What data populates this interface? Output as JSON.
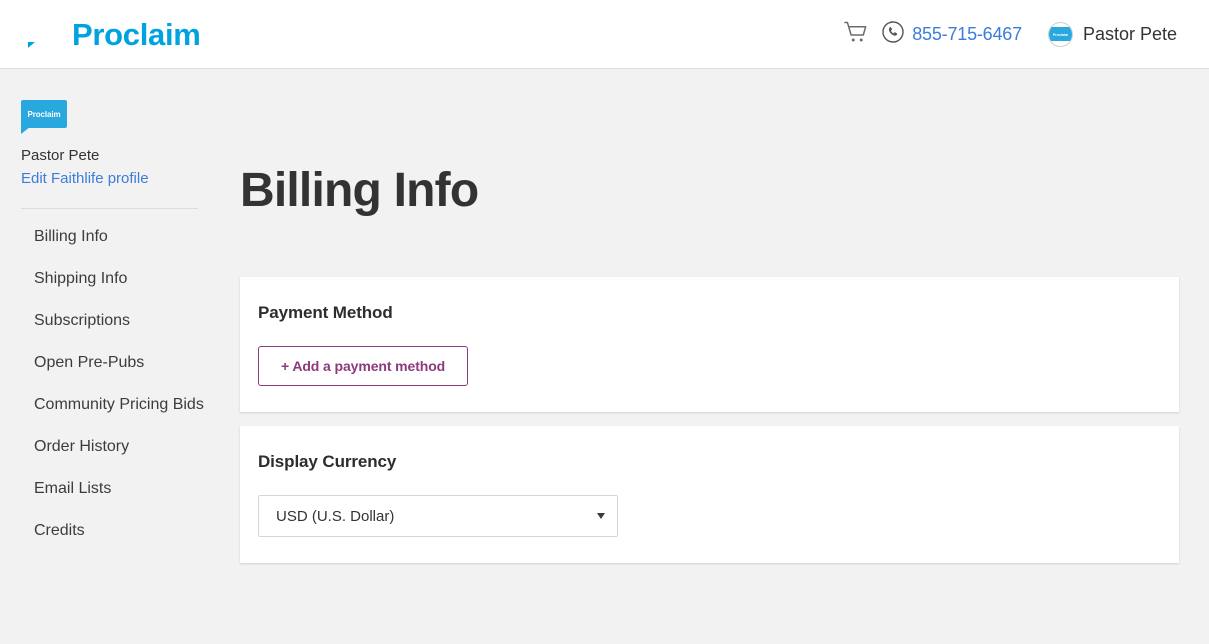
{
  "header": {
    "brand_name": "Proclaim",
    "brand_color": "#00a3e0",
    "cart_icon": "shopping-cart-icon",
    "phone_icon": "phone-circle-icon",
    "phone_number": "855-715-6467",
    "phone_link_color": "#3b7dd8",
    "user_name": "Pastor Pete",
    "avatar_icon": "proclaim-avatar-icon",
    "avatar_label": "Proclaim"
  },
  "sidebar": {
    "logo_label": "Proclaim",
    "user_name": "Pastor Pete",
    "edit_profile_label": "Edit Faithlife profile",
    "items": [
      {
        "label": "Billing Info"
      },
      {
        "label": "Shipping Info"
      },
      {
        "label": "Subscriptions"
      },
      {
        "label": "Open Pre-Pubs"
      },
      {
        "label": "Community Pricing Bids"
      },
      {
        "label": "Order History"
      },
      {
        "label": "Email Lists"
      },
      {
        "label": "Credits"
      }
    ]
  },
  "main": {
    "page_title": "Billing Info",
    "payment_method": {
      "title": "Payment Method",
      "add_button_label": "+ Add a payment method",
      "accent_color": "#8e3a7e"
    },
    "display_currency": {
      "title": "Display Currency",
      "selected": "USD (U.S. Dollar)",
      "options": [
        "USD (U.S. Dollar)"
      ],
      "caret_icon": "chevron-down-icon"
    }
  }
}
